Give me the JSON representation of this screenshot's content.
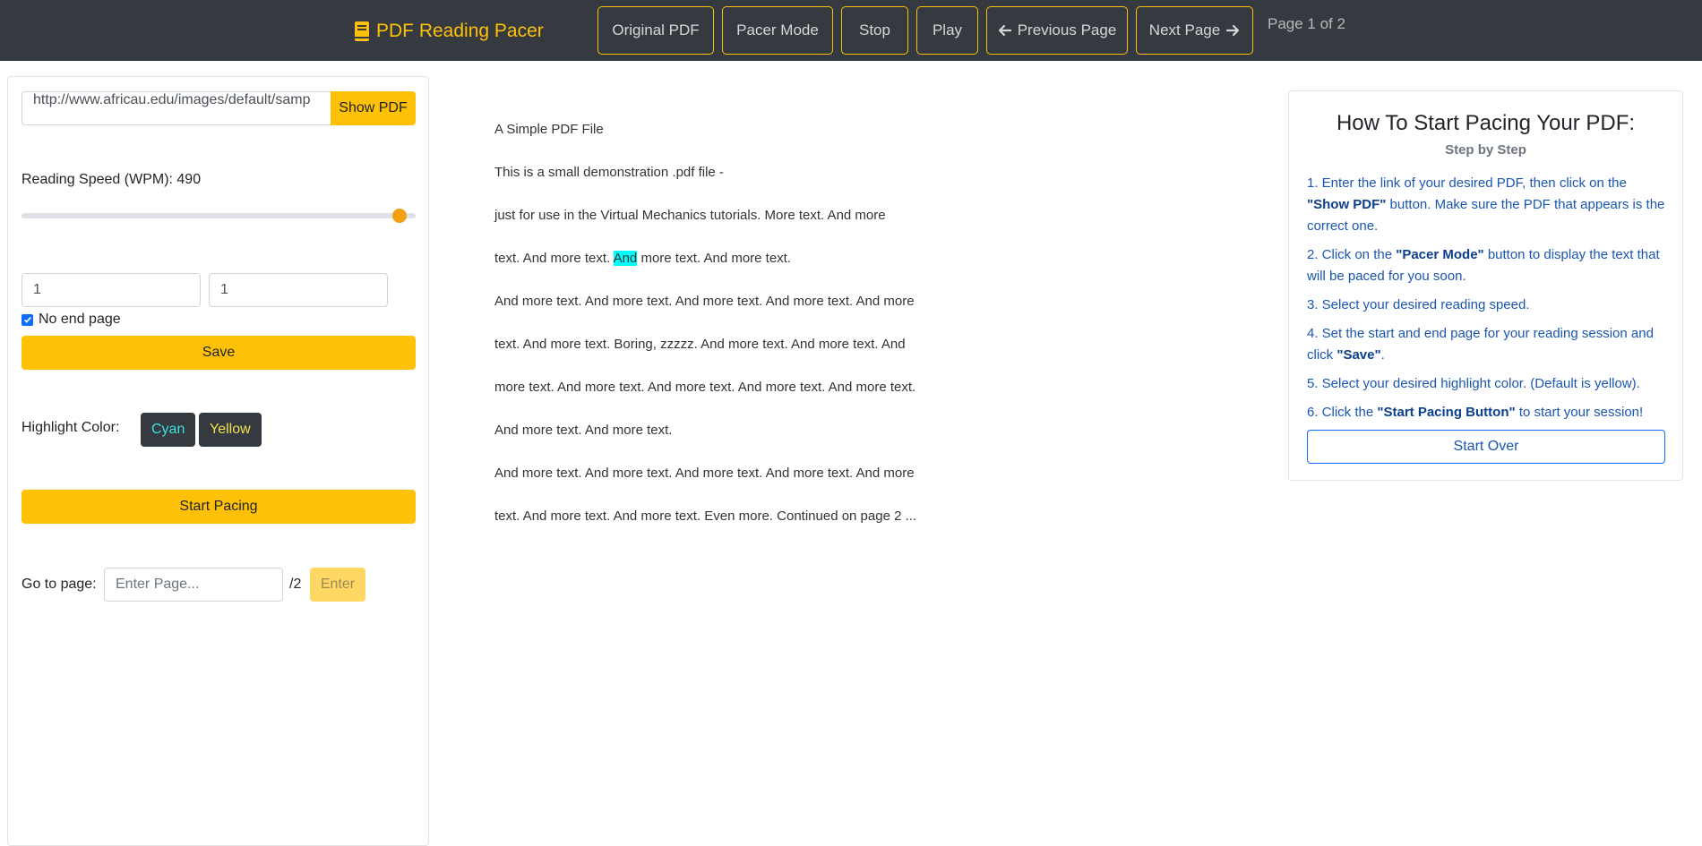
{
  "navbar": {
    "brand": "PDF Reading Pacer",
    "buttons": {
      "original_pdf": "Original PDF",
      "pacer_mode": "Pacer Mode",
      "stop": "Stop",
      "play": "Play",
      "previous_page": "Previous Page",
      "next_page": "Next Page"
    },
    "page_indicator": "Page 1 of 2"
  },
  "sidebar": {
    "url_value": "http://www.africau.edu/images/default/samp",
    "show_pdf": "Show PDF",
    "speed_label": "Reading Speed (WPM): 490",
    "speed_fraction": 0.96,
    "start_page": "1",
    "end_page": "1",
    "no_end_page_label": "No end page",
    "no_end_page_checked": true,
    "save": "Save",
    "highlight_label": "Highlight Color:",
    "color_cyan": "Cyan",
    "color_yellow": "Yellow",
    "start_pacing": "Start Pacing",
    "goto_label": "Go to page:",
    "goto_placeholder": "Enter Page...",
    "goto_total": "/2",
    "enter": "Enter"
  },
  "reader": {
    "lines": [
      "A Simple PDF File",
      "This is a small demonstration .pdf file -",
      "just for use in the Virtual Mechanics tutorials. More text. And more",
      "",
      "And more text. And more text. And more text. And more text. And more",
      "text. And more text. Boring, zzzzz. And more text. And more text. And",
      "more text. And more text. And more text. And more text. And more text.",
      "And more text. And more text.",
      "And more text. And more text. And more text. And more text. And more",
      "text. And more text. And more text. Even more. Continued on page 2 ..."
    ],
    "highlight_line": {
      "before": "text. And more text. ",
      "word": "And",
      "after": " more text. And more text."
    },
    "highlight_color": "#00ffff"
  },
  "instructions": {
    "title": "How To Start Pacing Your PDF:",
    "subtitle": "Step by Step",
    "steps": [
      {
        "pre": "1. Enter the link of your desired PDF, then click on the ",
        "bold": "\"Show PDF\"",
        "post": " button. Make sure the PDF that appears is the correct one."
      },
      {
        "pre": "2. Click on the ",
        "bold": "\"Pacer Mode\"",
        "post": " button to display the text that will be paced for you soon."
      },
      {
        "pre": "3. Select your desired reading speed.",
        "bold": "",
        "post": ""
      },
      {
        "pre": "4. Set the start and end page for your reading session and click ",
        "bold": "\"Save\"",
        "post": "."
      },
      {
        "pre": "5. Select your desired highlight color. (Default is yellow).",
        "bold": "",
        "post": ""
      },
      {
        "pre": "6. Click the ",
        "bold": "\"Start Pacing Button\"",
        "post": " to start your session!"
      }
    ],
    "start_over": "Start Over"
  },
  "colors": {
    "navbar_bg": "#343a40",
    "accent_yellow": "#ffc107",
    "highlight_cyan": "#00ffff",
    "link_blue": "#1a56b0"
  },
  "icons": [
    "book-icon",
    "arrow-left-icon",
    "arrow-right-icon",
    "check-icon"
  ]
}
